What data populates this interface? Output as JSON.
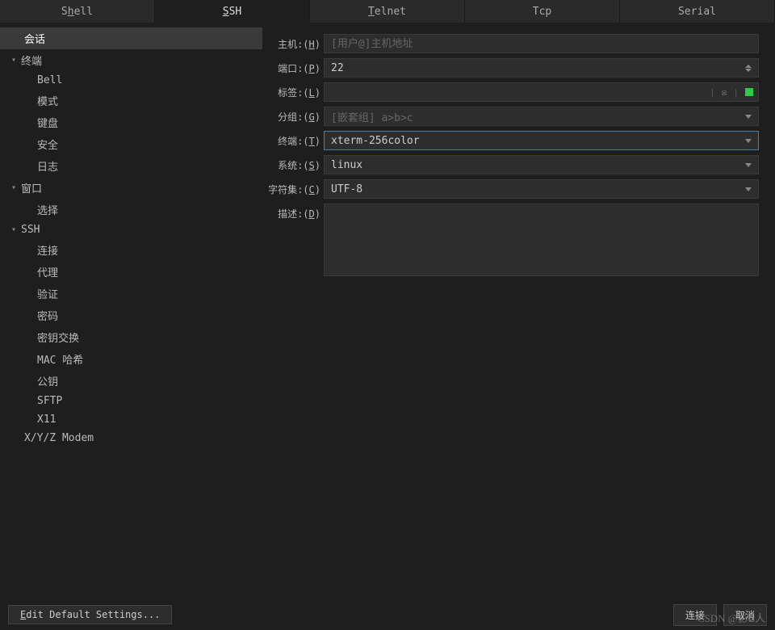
{
  "tabs": [
    {
      "label": "Shell",
      "underline": "h"
    },
    {
      "label": "SSH",
      "underline": "S",
      "active": true
    },
    {
      "label": "Telnet",
      "underline": "T"
    },
    {
      "label": "Tcp",
      "underline": ""
    },
    {
      "label": "Serial",
      "underline": ""
    }
  ],
  "sidebar": {
    "items": [
      {
        "label": "会话",
        "level": "root",
        "selected": true
      },
      {
        "label": "终端",
        "level": "parent",
        "expanded": true
      },
      {
        "label": "Bell",
        "level": "child"
      },
      {
        "label": "模式",
        "level": "child"
      },
      {
        "label": "键盘",
        "level": "child"
      },
      {
        "label": "安全",
        "level": "child"
      },
      {
        "label": "日志",
        "level": "child"
      },
      {
        "label": "窗口",
        "level": "parent",
        "expanded": true
      },
      {
        "label": "选择",
        "level": "child"
      },
      {
        "label": "SSH",
        "level": "parent",
        "expanded": true
      },
      {
        "label": "连接",
        "level": "child"
      },
      {
        "label": "代理",
        "level": "child"
      },
      {
        "label": "验证",
        "level": "child"
      },
      {
        "label": "密码",
        "level": "child"
      },
      {
        "label": "密钥交换",
        "level": "child"
      },
      {
        "label": "MAC 哈希",
        "level": "child"
      },
      {
        "label": "公钥",
        "level": "child"
      },
      {
        "label": "SFTP",
        "level": "child"
      },
      {
        "label": "X11",
        "level": "child"
      },
      {
        "label": "X/Y/Z Modem",
        "level": "root2"
      }
    ]
  },
  "form": {
    "host": {
      "label": "主机",
      "shortcut": "H",
      "placeholder": "[用户@]主机地址",
      "value": ""
    },
    "port": {
      "label": "端口",
      "shortcut": "P",
      "value": "22"
    },
    "tag": {
      "label": "标签",
      "shortcut": "L",
      "value": "",
      "icon_reset": "↻",
      "icon_clear": "☒"
    },
    "group": {
      "label": "分组",
      "shortcut": "G",
      "placeholder": "[嵌套组] a>b>c",
      "value": ""
    },
    "term": {
      "label": "终端",
      "shortcut": "T",
      "value": "xterm-256color"
    },
    "system": {
      "label": "系统",
      "shortcut": "S",
      "value": "linux"
    },
    "charset": {
      "label": "字符集",
      "shortcut": "C",
      "value": "UTF-8"
    },
    "desc": {
      "label": "描述",
      "shortcut": "D",
      "value": ""
    }
  },
  "footer": {
    "edit_defaults": "Edit Default Settings...",
    "connect": "连接",
    "cancel": "取消"
  },
  "watermark": "CSDN @影ະ人"
}
